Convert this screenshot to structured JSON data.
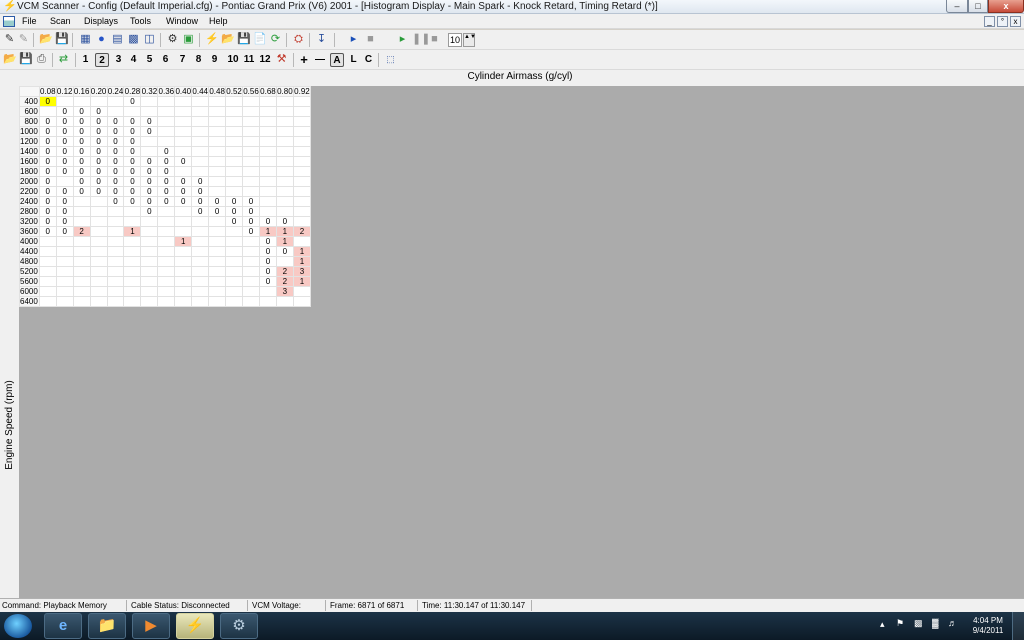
{
  "window": {
    "title": "VCM Scanner  -  Config  (Default Imperial.cfg)  -  Pontiac Grand Prix (V6) 2001  - [Histogram Display   -   Main Spark - Knock Retard,  Timing Retard  (*)]",
    "min_label": "–",
    "max_label": "□",
    "close_label": "x"
  },
  "menu": {
    "items": [
      "File",
      "Scan",
      "Displays",
      "Tools",
      "Window",
      "Help"
    ],
    "mdi_controls": [
      "_",
      "°",
      "x"
    ]
  },
  "toolbar1": {
    "zoom_value": "10",
    "spin_arrows": "▲▼"
  },
  "toolbar2": {
    "numbers": [
      "1",
      "2",
      "3",
      "4",
      "5",
      "6",
      "7",
      "8",
      "9",
      "10",
      "11",
      "12"
    ],
    "active_number": "2",
    "plus": "+",
    "minus": "—",
    "letters": [
      "A",
      "L",
      "C"
    ]
  },
  "histogram": {
    "x_axis_label": "Cylinder Airmass (g/cyl)",
    "y_axis_label": "Engine Speed (rpm)",
    "columns": [
      "0.08",
      "0.12",
      "0.16",
      "0.20",
      "0.24",
      "0.28",
      "0.32",
      "0.36",
      "0.40",
      "0.44",
      "0.48",
      "0.52",
      "0.56",
      "0.68",
      "0.80",
      "0.92"
    ],
    "rows": [
      {
        "rpm": "400",
        "cells": [
          "0",
          "",
          "",
          "",
          "",
          "0",
          "",
          "",
          "",
          "",
          "",
          "",
          "",
          "",
          "",
          ""
        ]
      },
      {
        "rpm": "600",
        "cells": [
          "",
          "0",
          "0",
          "0",
          "",
          "",
          "",
          "",
          "",
          "",
          "",
          "",
          "",
          "",
          "",
          ""
        ]
      },
      {
        "rpm": "800",
        "cells": [
          "0",
          "0",
          "0",
          "0",
          "0",
          "0",
          "0",
          "",
          "",
          "",
          "",
          "",
          "",
          "",
          "",
          ""
        ]
      },
      {
        "rpm": "1000",
        "cells": [
          "0",
          "0",
          "0",
          "0",
          "0",
          "0",
          "0",
          "",
          "",
          "",
          "",
          "",
          "",
          "",
          "",
          ""
        ]
      },
      {
        "rpm": "1200",
        "cells": [
          "0",
          "0",
          "0",
          "0",
          "0",
          "0",
          "",
          "",
          "",
          "",
          "",
          "",
          "",
          "",
          "",
          ""
        ]
      },
      {
        "rpm": "1400",
        "cells": [
          "0",
          "0",
          "0",
          "0",
          "0",
          "0",
          "",
          "0",
          "",
          "",
          "",
          "",
          "",
          "",
          "",
          ""
        ]
      },
      {
        "rpm": "1600",
        "cells": [
          "0",
          "0",
          "0",
          "0",
          "0",
          "0",
          "0",
          "0",
          "0",
          "",
          "",
          "",
          "",
          "",
          "",
          ""
        ]
      },
      {
        "rpm": "1800",
        "cells": [
          "0",
          "0",
          "0",
          "0",
          "0",
          "0",
          "0",
          "0",
          "",
          "",
          "",
          "",
          "",
          "",
          "",
          ""
        ]
      },
      {
        "rpm": "2000",
        "cells": [
          "0",
          "",
          "0",
          "0",
          "0",
          "0",
          "0",
          "0",
          "0",
          "0",
          "",
          "",
          "",
          "",
          "",
          ""
        ]
      },
      {
        "rpm": "2200",
        "cells": [
          "0",
          "0",
          "0",
          "0",
          "0",
          "0",
          "0",
          "0",
          "0",
          "0",
          "",
          "",
          "",
          "",
          "",
          ""
        ]
      },
      {
        "rpm": "2400",
        "cells": [
          "0",
          "0",
          "",
          "",
          "0",
          "0",
          "0",
          "0",
          "0",
          "0",
          "0",
          "0",
          "0",
          "",
          "",
          ""
        ]
      },
      {
        "rpm": "2800",
        "cells": [
          "0",
          "0",
          "",
          "",
          "",
          "",
          "0",
          "",
          "",
          "0",
          "0",
          "0",
          "0",
          "",
          "",
          ""
        ]
      },
      {
        "rpm": "3200",
        "cells": [
          "0",
          "0",
          "",
          "",
          "",
          "",
          "",
          "",
          "",
          "",
          "",
          "0",
          "0",
          "0",
          "0",
          ""
        ]
      },
      {
        "rpm": "3600",
        "cells": [
          "0",
          "0",
          "2",
          "",
          "",
          "1",
          "",
          "",
          "",
          "",
          "",
          "",
          "0",
          "1",
          "1",
          "2"
        ]
      },
      {
        "rpm": "4000",
        "cells": [
          "",
          "",
          "",
          "",
          "",
          "",
          "",
          "",
          "1",
          "",
          "",
          "",
          "",
          "0",
          "1",
          ""
        ]
      },
      {
        "rpm": "4400",
        "cells": [
          "",
          "",
          "",
          "",
          "",
          "",
          "",
          "",
          "",
          "",
          "",
          "",
          "",
          "0",
          "0",
          "1"
        ]
      },
      {
        "rpm": "4800",
        "cells": [
          "",
          "",
          "",
          "",
          "",
          "",
          "",
          "",
          "",
          "",
          "",
          "",
          "",
          "0",
          "",
          "1"
        ]
      },
      {
        "rpm": "5200",
        "cells": [
          "",
          "",
          "",
          "",
          "",
          "",
          "",
          "",
          "",
          "",
          "",
          "",
          "",
          "0",
          "2",
          "3"
        ]
      },
      {
        "rpm": "5600",
        "cells": [
          "",
          "",
          "",
          "",
          "",
          "",
          "",
          "",
          "",
          "",
          "",
          "",
          "",
          "0",
          "2",
          "1"
        ]
      },
      {
        "rpm": "6000",
        "cells": [
          "",
          "",
          "",
          "",
          "",
          "",
          "",
          "",
          "",
          "",
          "",
          "",
          "",
          "",
          "3",
          ""
        ]
      },
      {
        "rpm": "6400",
        "cells": [
          "",
          "",
          "",
          "",
          "",
          "",
          "",
          "",
          "",
          "",
          "",
          "",
          "",
          "",
          "",
          ""
        ]
      }
    ],
    "highlight_color": "#f8c9c4",
    "selected_color": "#ffff00"
  },
  "statusbar": {
    "command": "Command:  Playback Memory",
    "cable": "Cable Status:  Disconnected",
    "voltage": "VCM Voltage:",
    "frame": "Frame:  6871 of 6871",
    "time": "Time:  11:30.147 of 11:30.147"
  },
  "taskbar": {
    "time": "4:04 PM",
    "date": "9/4/2011"
  }
}
